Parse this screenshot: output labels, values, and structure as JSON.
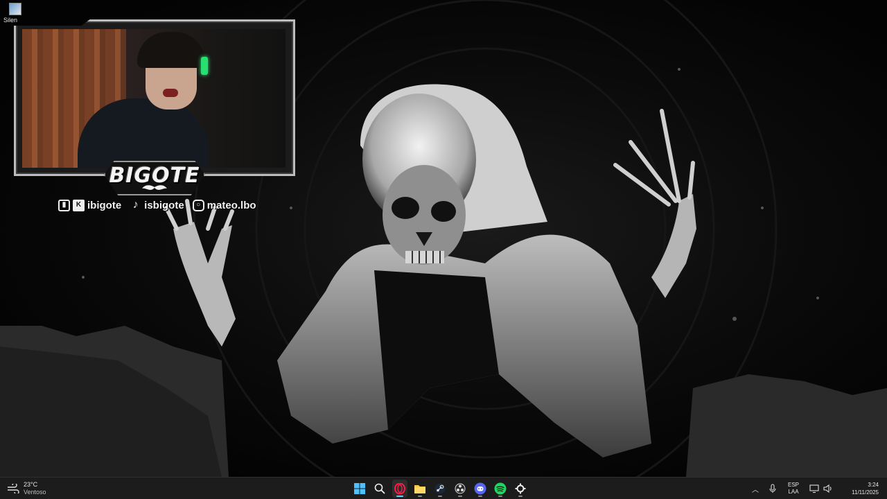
{
  "desktop": {
    "icon_label": "Silen"
  },
  "overlay": {
    "brand": "BIGOTE",
    "socials": [
      {
        "icon": "twitch-kick-icon",
        "handle": "ibigote"
      },
      {
        "icon": "tiktok-icon",
        "handle": "isbigote"
      },
      {
        "icon": "instagram-icon",
        "handle": "mateo.lbo"
      }
    ]
  },
  "taskbar": {
    "weather": {
      "temp": "23°C",
      "condition": "Ventoso"
    },
    "apps": [
      "start-icon",
      "search-icon",
      "opera-gx-icon",
      "file-explorer-icon",
      "steam-icon",
      "obs-icon",
      "discord-icon",
      "spotify-icon",
      "steelseries-icon"
    ],
    "active_app": "opera-gx-icon",
    "lang": {
      "line1": "ESP",
      "line2": "LAA"
    },
    "clock": {
      "time": "3:24",
      "date": "11/11/2025"
    }
  },
  "colors": {
    "taskbar": "#1c1c1c",
    "accent": "#60cdff",
    "spotify": "#1ed760",
    "discord": "#5865f2"
  }
}
